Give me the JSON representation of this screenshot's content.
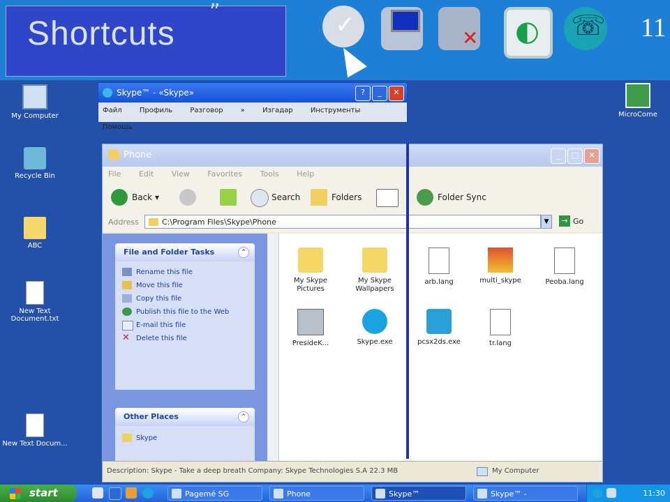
{
  "banner": {
    "title": "Shortcuts",
    "number": "11",
    "icons": [
      "check-icon",
      "network-icon",
      "network-disconnected-icon",
      "green-app-icon",
      "skype-icon"
    ]
  },
  "desktop": {
    "icons": [
      {
        "name": "my-computer",
        "label": "My Computer",
        "icon": "computer-icon"
      },
      {
        "name": "recycle-bin",
        "label": "Recycle Bin",
        "icon": "recycle-bin-icon"
      },
      {
        "name": "folder",
        "label": "ABC",
        "icon": "folder-icon"
      },
      {
        "name": "new-text-doc",
        "label": "New Text Document.txt",
        "icon": "text-document-icon"
      },
      {
        "name": "new-text-doc-2",
        "label": "New Text Docum...",
        "icon": "text-document-icon"
      },
      {
        "name": "share-icon-right",
        "label": "MicroCome",
        "icon": "share-icon"
      }
    ]
  },
  "mini_window": {
    "title": "Skype™ - «Skype»",
    "menu": [
      "Файл",
      "Профиль",
      "Разговор",
      "»",
      "Изгадар",
      "Инструменты",
      "Помощь"
    ]
  },
  "explorer": {
    "title": "Phone",
    "menu": [
      "File",
      "Edit",
      "View",
      "Favorites",
      "Tools",
      "Help"
    ],
    "toolbar": {
      "back": "Back",
      "search": "Search",
      "folders": "Folders",
      "folder_sync": "Folder Sync"
    },
    "address_label": "Address",
    "address": "C:\\Program Files\\Skype\\Phone",
    "go": "Go",
    "tasks_header": "File and Folder Tasks",
    "tasks": [
      "Rename this file",
      "Move this file",
      "Copy this file",
      "Publish this file to the Web",
      "E-mail this file",
      "Delete this file"
    ],
    "other_places_header": "Other Places",
    "other_places": [
      "Skype"
    ],
    "files": [
      {
        "label": "My Skype Pictures",
        "type": "folder"
      },
      {
        "label": "My Skype Wallpapers",
        "type": "folder"
      },
      {
        "label": "arb.lang",
        "type": "doc"
      },
      {
        "label": "multi_skype",
        "type": "app"
      },
      {
        "label": "Peoba.lang",
        "type": "doc"
      },
      {
        "label": "PresideK...",
        "type": "dll"
      },
      {
        "label": "Skype.exe",
        "type": "skype"
      },
      {
        "label": "pcsx2ds.exe",
        "type": "cube"
      },
      {
        "label": "tr.lang",
        "type": "doc"
      }
    ],
    "status_left": "Description: Skype - Take a deep breath Company: Skype Technologies S.A 22.3 MB",
    "status_right": "My Computer"
  },
  "taskbar": {
    "start": "start",
    "tasks": [
      "Pagemé SG",
      "Phone",
      "Skype™",
      "Skype™ -"
    ],
    "clock": "11:30"
  }
}
